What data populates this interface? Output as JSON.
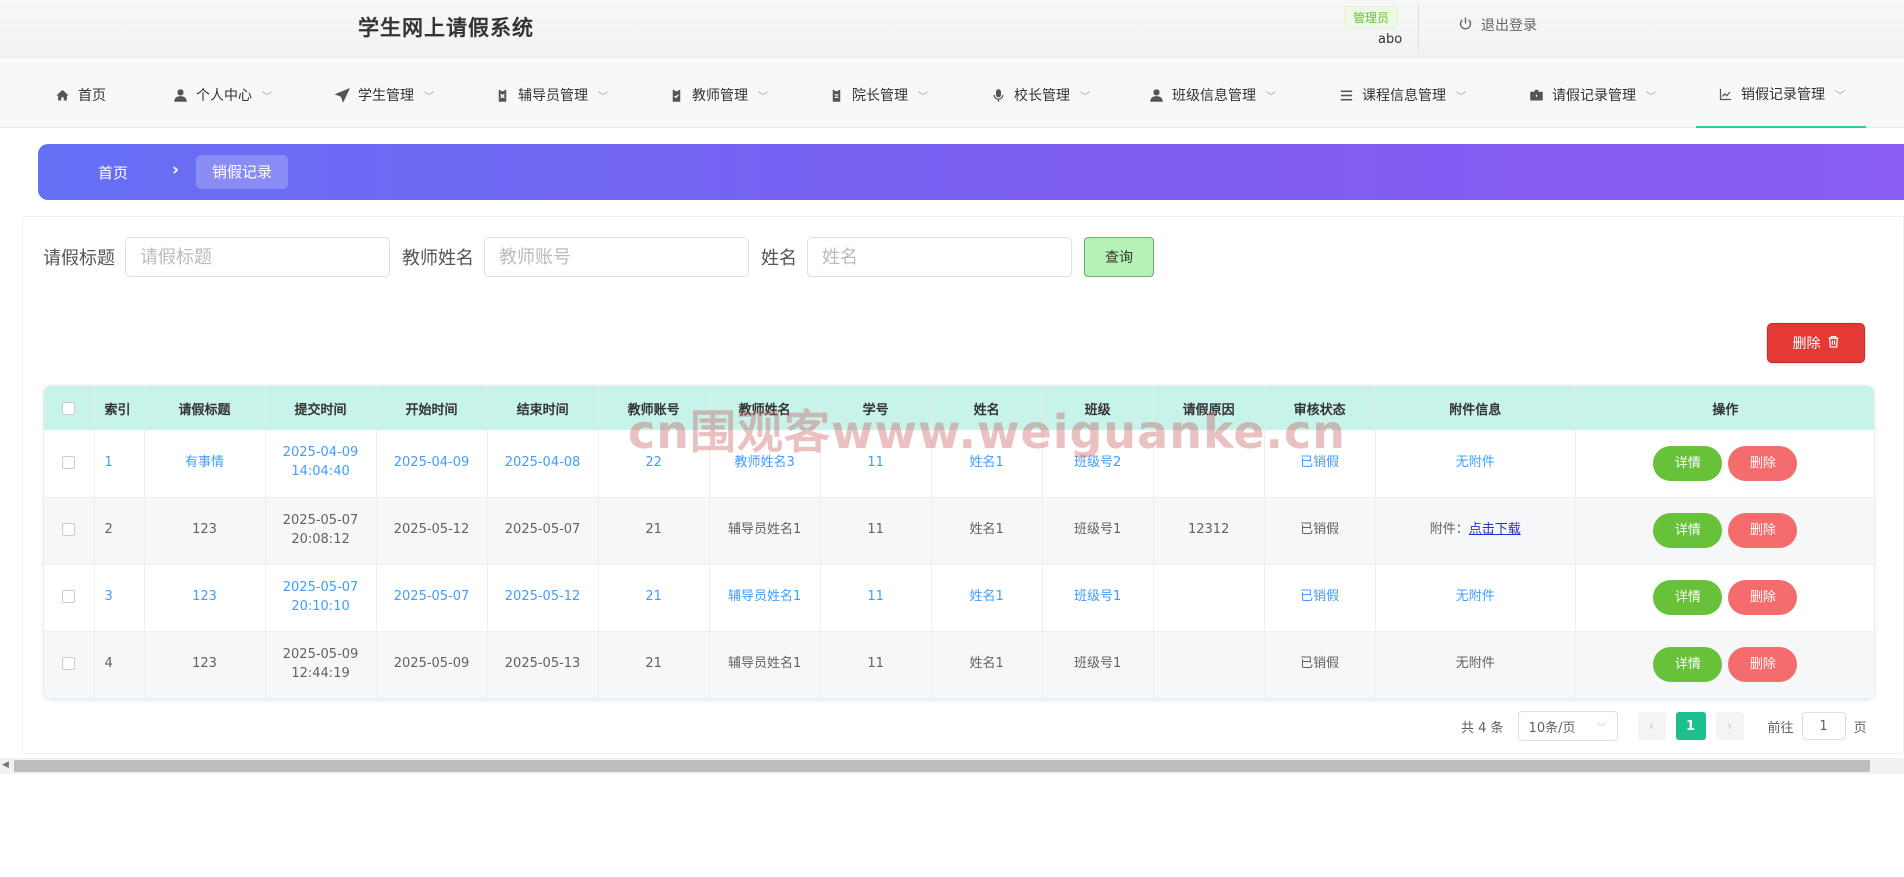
{
  "header": {
    "app_title": "学生网上请假系统",
    "role_badge": "管理员",
    "username": "abo",
    "logout_label": "退出登录"
  },
  "nav": {
    "items": [
      {
        "label": "首页",
        "icon": "home-icon"
      },
      {
        "label": "个人中心",
        "icon": "user-icon"
      },
      {
        "label": "学生管理",
        "icon": "send-icon"
      },
      {
        "label": "辅导员管理",
        "icon": "clipboard-x-icon"
      },
      {
        "label": "教师管理",
        "icon": "clipboard-check-icon"
      },
      {
        "label": "院长管理",
        "icon": "clipboard-icon"
      },
      {
        "label": "校长管理",
        "icon": "microphone-icon"
      },
      {
        "label": "班级信息管理",
        "icon": "user-icon"
      },
      {
        "label": "课程信息管理",
        "icon": "list-icon"
      },
      {
        "label": "请假记录管理",
        "icon": "briefcase-icon"
      },
      {
        "label": "销假记录管理",
        "icon": "chart-icon"
      }
    ]
  },
  "breadcrumb": {
    "home": "首页",
    "separator": "›",
    "current": "销假记录"
  },
  "search": {
    "title_label": "请假标题",
    "title_placeholder": "请假标题",
    "teacher_label": "教师姓名",
    "teacher_placeholder": "教师账号",
    "name_label": "姓名",
    "name_placeholder": "姓名",
    "query_button": "查询"
  },
  "toolbar": {
    "delete_label": "删除"
  },
  "table": {
    "columns": [
      "索引",
      "请假标题",
      "提交时间",
      "开始时间",
      "结束时间",
      "教师账号",
      "教师姓名",
      "学号",
      "姓名",
      "班级",
      "请假原因",
      "审核状态",
      "附件信息",
      "操作"
    ],
    "rows": [
      {
        "index": "1",
        "title": "有事情",
        "submit_date": "2025-04-09",
        "submit_time": "14:04:40",
        "start": "2025-04-09",
        "end": "2025-04-08",
        "teacher_account": "22",
        "teacher_name": "教师姓名3",
        "student_no": "11",
        "name": "姓名1",
        "class": "班级号2",
        "reason": "",
        "status": "已销假",
        "attachment_prefix": "",
        "attachment_link": "",
        "attachment_text": "无附件",
        "detail": "详情",
        "delete": "删除"
      },
      {
        "index": "2",
        "title": "123",
        "submit_date": "2025-05-07",
        "submit_time": "20:08:12",
        "start": "2025-05-12",
        "end": "2025-05-07",
        "teacher_account": "21",
        "teacher_name": "辅导员姓名1",
        "student_no": "11",
        "name": "姓名1",
        "class": "班级号1",
        "reason": "12312",
        "status": "已销假",
        "attachment_prefix": "附件：",
        "attachment_link": "点击下载",
        "attachment_text": "",
        "detail": "详情",
        "delete": "删除"
      },
      {
        "index": "3",
        "title": "123",
        "submit_date": "2025-05-07",
        "submit_time": "20:10:10",
        "start": "2025-05-07",
        "end": "2025-05-12",
        "teacher_account": "21",
        "teacher_name": "辅导员姓名1",
        "student_no": "11",
        "name": "姓名1",
        "class": "班级号1",
        "reason": "",
        "status": "已销假",
        "attachment_prefix": "",
        "attachment_link": "",
        "attachment_text": "无附件",
        "detail": "详情",
        "delete": "删除"
      },
      {
        "index": "4",
        "title": "123",
        "submit_date": "2025-05-09",
        "submit_time": "12:44:19",
        "start": "2025-05-09",
        "end": "2025-05-13",
        "teacher_account": "21",
        "teacher_name": "辅导员姓名1",
        "student_no": "11",
        "name": "姓名1",
        "class": "班级号1",
        "reason": "",
        "status": "已销假",
        "attachment_prefix": "",
        "attachment_link": "",
        "attachment_text": "无附件",
        "detail": "详情",
        "delete": "删除"
      }
    ]
  },
  "pagination": {
    "total": "共 4 条",
    "page_size": "10条/页",
    "current_page": "1",
    "goto_label": "前往",
    "goto_value": "1",
    "page_suffix": "页"
  },
  "watermark": "cn围观客www.weiguanke.cn",
  "colors": {
    "accent": "#1dbf8f",
    "banner_start": "#6570f5",
    "banner_end": "#8a5cf3",
    "delete_red": "#e53935",
    "detail_green": "#67c23a",
    "row_delete_pink": "#f56c6c",
    "table_header": "#c8f3ea",
    "link_blue": "#409eff"
  }
}
